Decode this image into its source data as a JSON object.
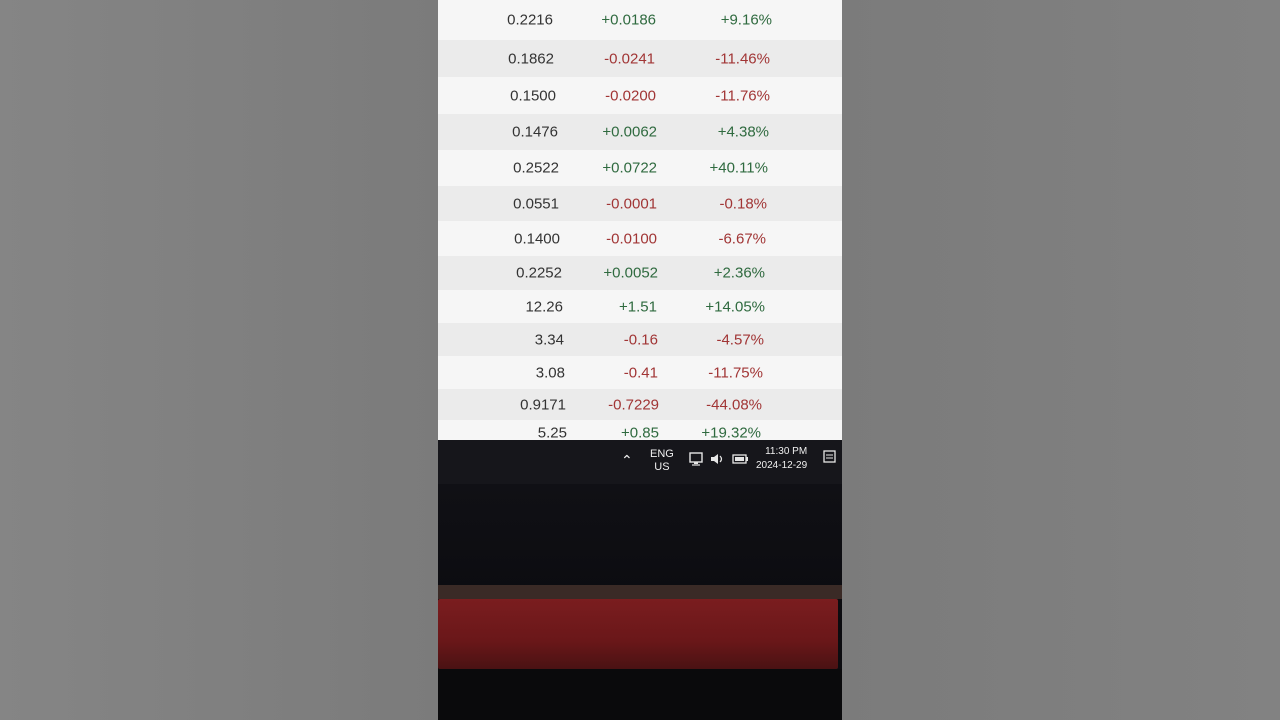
{
  "table": {
    "rows": [
      {
        "price": "0.2216",
        "change": "+0.0186",
        "pct": "+9.16%",
        "dir": "up"
      },
      {
        "price": "0.1862",
        "change": "-0.0241",
        "pct": "-11.46%",
        "dir": "down"
      },
      {
        "price": "0.1500",
        "change": "-0.0200",
        "pct": "-11.76%",
        "dir": "down"
      },
      {
        "price": "0.1476",
        "change": "+0.0062",
        "pct": "+4.38%",
        "dir": "up"
      },
      {
        "price": "0.2522",
        "change": "+0.0722",
        "pct": "+40.11%",
        "dir": "up"
      },
      {
        "price": "0.0551",
        "change": "-0.0001",
        "pct": "-0.18%",
        "dir": "down"
      },
      {
        "price": "0.1400",
        "change": "-0.0100",
        "pct": "-6.67%",
        "dir": "down"
      },
      {
        "price": "0.2252",
        "change": "+0.0052",
        "pct": "+2.36%",
        "dir": "up"
      },
      {
        "price": "12.26",
        "change": "+1.51",
        "pct": "+14.05%",
        "dir": "up"
      },
      {
        "price": "3.34",
        "change": "-0.16",
        "pct": "-4.57%",
        "dir": "down"
      },
      {
        "price": "3.08",
        "change": "-0.41",
        "pct": "-11.75%",
        "dir": "down"
      },
      {
        "price": "0.9171",
        "change": "-0.7229",
        "pct": "-44.08%",
        "dir": "down"
      },
      {
        "price": "5.25",
        "change": "+0.85",
        "pct": "+19.32%",
        "dir": "up"
      }
    ]
  },
  "taskbar": {
    "lang_line1": "ENG",
    "lang_line2": "US",
    "time": "11:30 PM",
    "date": "2024-12-29",
    "icons": [
      "chevron-up-icon",
      "network-icon",
      "volume-icon",
      "battery-icon",
      "notification-icon"
    ]
  },
  "colors": {
    "up": "#2f6a3f",
    "down": "#a13535",
    "taskbar": "#16161b"
  }
}
